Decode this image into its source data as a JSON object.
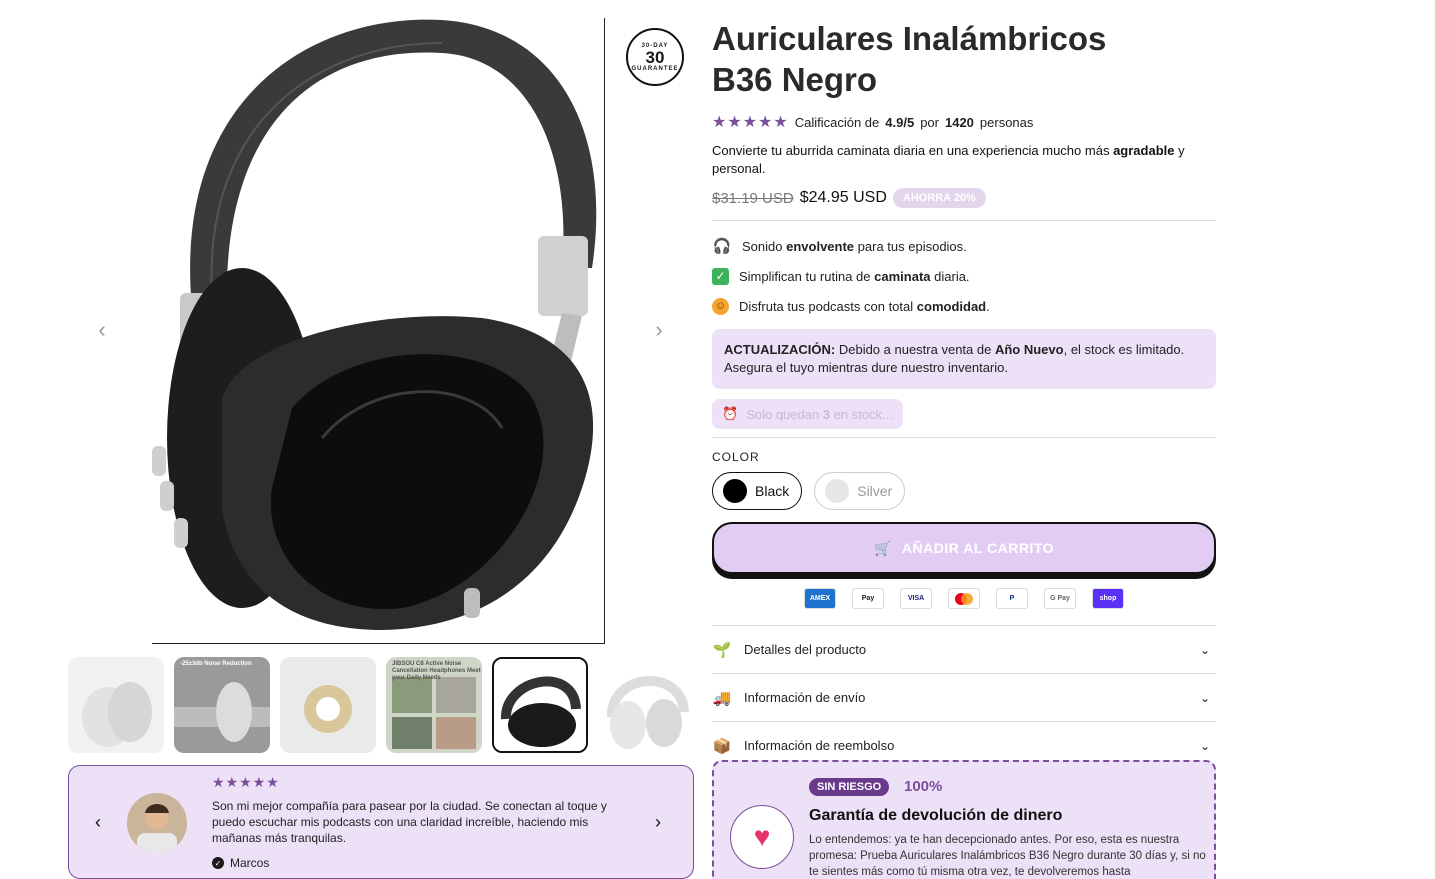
{
  "gallery": {
    "badge": {
      "top": "30-DAY",
      "num": "30",
      "bottom": "GUARANTEE"
    },
    "prev_arrow": "‹",
    "next_arrow": "›",
    "thumbs": [
      {
        "caption": "",
        "tone": "#e9e9e9"
      },
      {
        "caption": "-25±3db Noise Reduction",
        "tone": "#b8b8b8"
      },
      {
        "caption": "",
        "tone": "#efefef"
      },
      {
        "caption": "JIBSOU C8 Active Noise Cancellation Headphones Meet your Daily Needs",
        "tone": "#cfd6c8"
      },
      {
        "caption": "",
        "tone": "#ffffff"
      },
      {
        "caption": "",
        "tone": "#f2f2f2"
      }
    ]
  },
  "testimonial": {
    "stars": "★★★★★",
    "text": "Son mi mejor compañía para pasear por la ciudad. Se conectan al toque y puedo escuchar mis podcasts con una claridad increíble, haciendo mis mañanas más tranquilas.",
    "author": "Marcos",
    "verified_mark": "✓",
    "prev": "‹",
    "next": "›"
  },
  "product": {
    "title": "Auriculares Inalámbricos B36 Negro",
    "stars": "★★★★★",
    "rating_prefix": "Calificación de",
    "rating_value": "4.9/5",
    "rating_mid": "por",
    "rating_count": "1420",
    "rating_suffix": "personas",
    "desc_1": "Convierte tu aburrida caminata diaria en una experiencia mucho más",
    "desc_bold": "agradable",
    "desc_2": "y personal.",
    "old_price": "$31.19 USD",
    "new_price": "$24.95 USD",
    "save": "AHORRA 20%",
    "features": [
      {
        "pre": "Sonido",
        "bold": "envolvente",
        "post": "para tus episodios."
      },
      {
        "pre": "Simplifican tu rutina de",
        "bold": "caminata",
        "post": "diaria."
      },
      {
        "pre": "Disfruta tus podcasts con total",
        "bold": "comodidad",
        "post": "."
      }
    ],
    "update_label": "ACTUALIZACIÓN:",
    "update_pre": "Debido a nuestra venta de",
    "update_bold": "Año Nuevo",
    "update_post": ", el stock es limitado. Asegura el tuyo mientras dure nuestro inventario.",
    "stock_pre": "Solo quedan",
    "stock_num": "3",
    "stock_post": "en stock...",
    "color_label": "COLOR",
    "swatches": [
      {
        "label": "Black",
        "color": "#000000"
      },
      {
        "label": "Silver",
        "color": "#e6e6e6"
      }
    ],
    "cart_label": "AÑADIR AL CARRITO",
    "payments": [
      "AMEX",
      "Pay",
      "VISA",
      "",
      "P",
      "G Pay",
      "shop"
    ],
    "accordion": [
      {
        "label": "Detalles del producto",
        "icon": "🌱"
      },
      {
        "label": "Información de envío",
        "icon": "🚚"
      },
      {
        "label": "Información de reembolso",
        "icon": "📦"
      }
    ]
  },
  "guarantee": {
    "pill": "SIN RIESGO",
    "pct": "100%",
    "title": "Garantía de devolución de dinero",
    "text": "Lo entendemos: ya te han decepcionado antes. Por eso, esta es nuestra promesa: Prueba Auriculares Inalámbricos B36 Negro durante 30 días y, si no te sientes más como tú misma otra vez, te devolveremos hasta"
  },
  "colors": {
    "accent": "#7b4e9c",
    "accent_light": "#ece1f7"
  }
}
